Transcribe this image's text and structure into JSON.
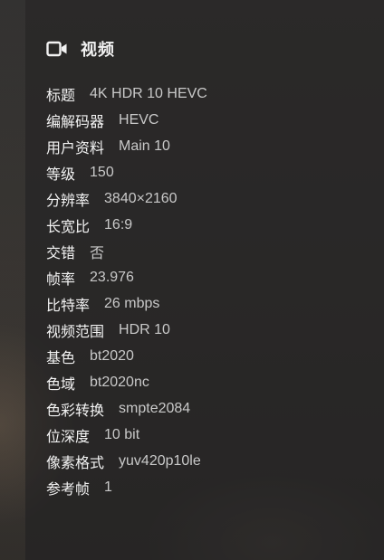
{
  "section": {
    "title": "视频",
    "icon": "video-camera-icon"
  },
  "rows": [
    {
      "label": "标题",
      "value": "4K HDR 10 HEVC"
    },
    {
      "label": "编解码器",
      "value": "HEVC"
    },
    {
      "label": "用户资料",
      "value": "Main 10"
    },
    {
      "label": "等级",
      "value": "150"
    },
    {
      "label": "分辨率",
      "value": "3840×2160"
    },
    {
      "label": "长宽比",
      "value": "16:9"
    },
    {
      "label": "交错",
      "value": "否"
    },
    {
      "label": "帧率",
      "value": "23.976"
    },
    {
      "label": "比特率",
      "value": "26 mbps"
    },
    {
      "label": "视频范围",
      "value": "HDR 10"
    },
    {
      "label": "基色",
      "value": "bt2020"
    },
    {
      "label": "色域",
      "value": "bt2020nc"
    },
    {
      "label": "色彩转换",
      "value": "smpte2084"
    },
    {
      "label": "位深度",
      "value": "10 bit"
    },
    {
      "label": "像素格式",
      "value": "yuv420p10le"
    },
    {
      "label": "参考帧",
      "value": "1"
    }
  ]
}
